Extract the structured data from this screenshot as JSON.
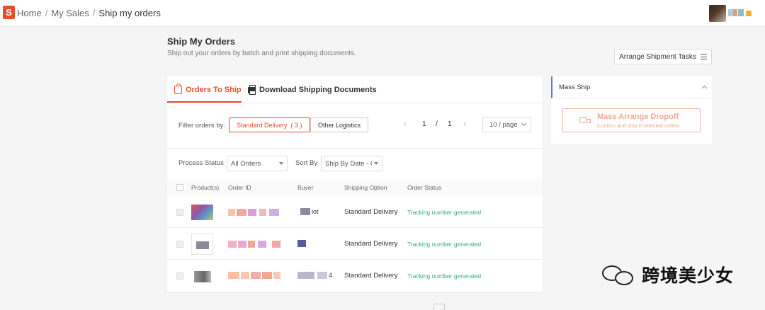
{
  "breadcrumb": {
    "logo_glyph": "S",
    "home": "Home",
    "sales": "My Sales",
    "current": "Ship my orders",
    "sep": "/"
  },
  "page": {
    "title": "Ship My Orders",
    "subtitle": "Ship out your orders by batch and print shipping documents.",
    "arrange_label": "Arrange Shipment Tasks"
  },
  "tabs": {
    "to_ship": "Orders To Ship",
    "download": "Download Shipping Documents"
  },
  "filter": {
    "label": "Filter orders by:",
    "standard": "Standard Delivery  ( 3 )",
    "other": "Other Logistics"
  },
  "pager": {
    "current": "1",
    "sep": "/",
    "total": "1",
    "prev": "‹",
    "next": "›",
    "per_page": "10 / page"
  },
  "controls": {
    "process_label": "Process Status",
    "process_value": "All Orders",
    "sort_label": "Sort By",
    "sort_value": "Ship By Date - C"
  },
  "table": {
    "headers": [
      "Product(s)",
      "Order ID",
      "Buyer",
      "Shipping Option",
      "Order Status"
    ],
    "rows": [
      {
        "shipping": "Standard Delivery",
        "status": "Tracking number generated",
        "buyer_suffix": "iot"
      },
      {
        "shipping": "Standard Delivery",
        "status": "Tracking number generated",
        "buyer_suffix": ""
      },
      {
        "shipping": "Standard Delivery",
        "status": "Tracking number generated",
        "buyer_suffix": "4"
      }
    ]
  },
  "mass_ship": {
    "title": "Mass Ship",
    "button_title": "Mass Arrange Dropoff",
    "button_sub": "Confirm and ship 0 selected orders"
  },
  "watermark": {
    "text": "跨境美少女"
  },
  "colors": {
    "brand": "#ee4d2d",
    "status": "#2bb08b",
    "accent": "#4a7ee0"
  }
}
